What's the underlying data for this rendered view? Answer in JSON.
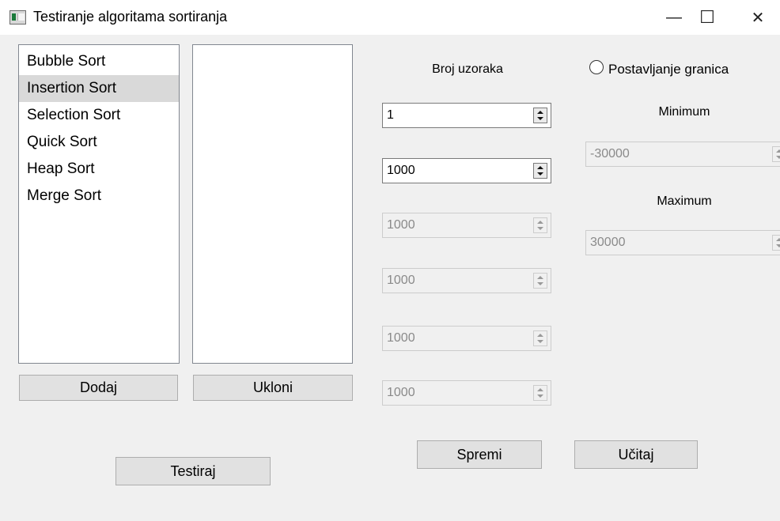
{
  "window": {
    "title": "Testiranje algoritama sortiranja",
    "minimize_icon": "—",
    "maximize_icon": "☐",
    "close_icon": "✕"
  },
  "algorithms": {
    "items": [
      "Bubble Sort",
      "Insertion Sort",
      "Selection Sort",
      "Quick Sort",
      "Heap Sort",
      "Merge Sort"
    ],
    "selected": "Insertion Sort"
  },
  "selected_list": {
    "items": []
  },
  "buttons": {
    "add": "Dodaj",
    "remove": "Ukloni",
    "test": "Testiraj",
    "save": "Spremi",
    "load": "Učitaj"
  },
  "samples": {
    "label": "Broj uzoraka",
    "count": "1",
    "sizes": [
      "1000",
      "1000",
      "1000",
      "1000",
      "1000"
    ],
    "sizes_enabled": [
      true,
      false,
      false,
      false,
      false
    ]
  },
  "bounds": {
    "radio_label": "Postavljanje granica",
    "checked": false,
    "min_label": "Minimum",
    "min_value": "-30000",
    "max_label": "Maximum",
    "max_value": "30000",
    "enabled": false
  }
}
